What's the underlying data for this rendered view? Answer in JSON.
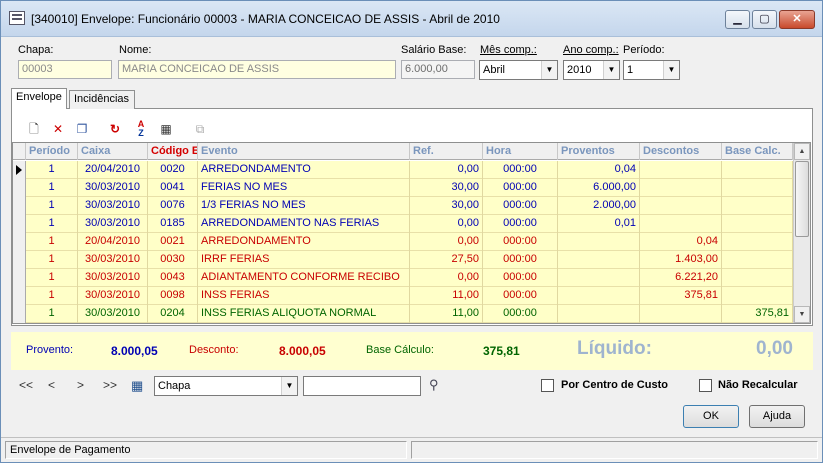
{
  "window": {
    "title": "[340010]  Envelope: Funcionário 00003 - MARIA CONCEICAO DE ASSIS - Abril de 2010",
    "minimize": "▁",
    "maximize": "▢",
    "close": "✕"
  },
  "form": {
    "chapa_label": "Chapa:",
    "chapa_value": "00003",
    "nome_label": "Nome:",
    "nome_value": "MARIA CONCEICAO DE ASSIS",
    "salario_label": "Salário Base:",
    "salario_value": "6.000,00",
    "mes_label": "Mês comp.:",
    "mes_value": "Abril",
    "ano_label": "Ano comp.:",
    "ano_value": "2010",
    "periodo_label": "Período:",
    "periodo_value": "1"
  },
  "tabs": [
    {
      "label": "Envelope"
    },
    {
      "label": "Incidências"
    }
  ],
  "toolbar_icons": [
    "new-record-icon",
    "delete-record-icon",
    "copy-record-icon",
    "refresh-icon",
    "sort-az-icon",
    "calculator-icon",
    "paste-icon"
  ],
  "grid": {
    "headers": [
      "Período",
      "Caixa",
      "Código E",
      "Evento",
      "Ref.",
      "Hora",
      "Proventos",
      "Descontos",
      "Base Calc."
    ],
    "rows": [
      {
        "periodo": "1",
        "caixa": "20/04/2010",
        "codigo": "0020",
        "evento": "ARREDONDAMENTO",
        "ref": "0,00",
        "hora": "000:00",
        "proventos": "0,04",
        "descontos": "",
        "base": "",
        "color": "#0000b4"
      },
      {
        "periodo": "1",
        "caixa": "30/03/2010",
        "codigo": "0041",
        "evento": "FERIAS NO MES",
        "ref": "30,00",
        "hora": "000:00",
        "proventos": "6.000,00",
        "descontos": "",
        "base": "",
        "color": "#0000b4"
      },
      {
        "periodo": "1",
        "caixa": "30/03/2010",
        "codigo": "0076",
        "evento": "1/3 FERIAS NO MES",
        "ref": "30,00",
        "hora": "000:00",
        "proventos": "2.000,00",
        "descontos": "",
        "base": "",
        "color": "#0000b4"
      },
      {
        "periodo": "1",
        "caixa": "30/03/2010",
        "codigo": "0185",
        "evento": "ARREDONDAMENTO NAS FERIAS",
        "ref": "0,00",
        "hora": "000:00",
        "proventos": "0,01",
        "descontos": "",
        "base": "",
        "color": "#0000b4"
      },
      {
        "periodo": "1",
        "caixa": "20/04/2010",
        "codigo": "0021",
        "evento": "ARREDONDAMENTO",
        "ref": "0,00",
        "hora": "000:00",
        "proventos": "",
        "descontos": "0,04",
        "base": "",
        "color": "#c80000"
      },
      {
        "periodo": "1",
        "caixa": "30/03/2010",
        "codigo": "0030",
        "evento": "IRRF FERIAS",
        "ref": "27,50",
        "hora": "000:00",
        "proventos": "",
        "descontos": "1.403,00",
        "base": "",
        "color": "#c80000"
      },
      {
        "periodo": "1",
        "caixa": "30/03/2010",
        "codigo": "0043",
        "evento": "ADIANTAMENTO CONFORME RECIBO",
        "ref": "0,00",
        "hora": "000:00",
        "proventos": "",
        "descontos": "6.221,20",
        "base": "",
        "color": "#c80000"
      },
      {
        "periodo": "1",
        "caixa": "30/03/2010",
        "codigo": "0098",
        "evento": "INSS FERIAS",
        "ref": "11,00",
        "hora": "000:00",
        "proventos": "",
        "descontos": "375,81",
        "base": "",
        "color": "#c80000"
      },
      {
        "periodo": "1",
        "caixa": "30/03/2010",
        "codigo": "0204",
        "evento": "INSS FERIAS ALIQUOTA NORMAL",
        "ref": "11,00",
        "hora": "000:00",
        "proventos": "",
        "descontos": "",
        "base": "375,81",
        "color": "#006400"
      }
    ]
  },
  "summary": {
    "proventos_label": "Provento:",
    "proventos_value": "8.000,05",
    "desconto_label": "Desconto:",
    "desconto_value": "8.000,05",
    "base_label": "Base Cálculo:",
    "base_value": "375,81",
    "liquido_label": "Líquido:",
    "liquido_value": "0,00"
  },
  "nav": {
    "first": "<<",
    "prev": "<",
    "next": ">",
    "last": ">>",
    "search_field": "Chapa",
    "search_value": ""
  },
  "options": {
    "centro_custo": "Por Centro de Custo",
    "nao_recalcular": "Não Recalcular"
  },
  "buttons": {
    "ok": "OK",
    "ajuda": "Ajuda"
  },
  "status": {
    "text": "Envelope de Pagamento"
  },
  "colors": {
    "provento": "#0000b4",
    "desconto": "#c80000",
    "base": "#006400",
    "liquido": "#9fb4cf",
    "grid_bg": "#ffffc8"
  }
}
